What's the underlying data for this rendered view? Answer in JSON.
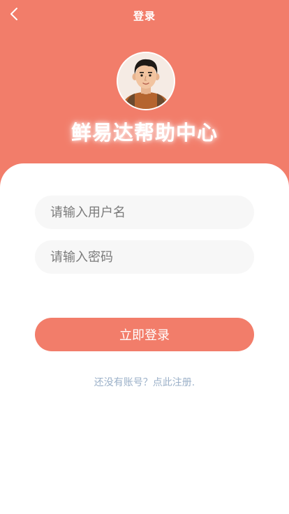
{
  "nav": {
    "title": "登录",
    "back_icon": "chevron-left-icon"
  },
  "brand": {
    "title": "鲜易达帮助中心",
    "avatar_icon": "user-avatar-icon"
  },
  "form": {
    "username_placeholder": "请输入用户名",
    "password_placeholder": "请输入密码",
    "login_label": "立即登录",
    "register_text": "还没有账号？点此注册."
  },
  "colors": {
    "accent": "#f27d6a",
    "input_bg": "#f7f7f7",
    "link": "#9bb0c8"
  }
}
